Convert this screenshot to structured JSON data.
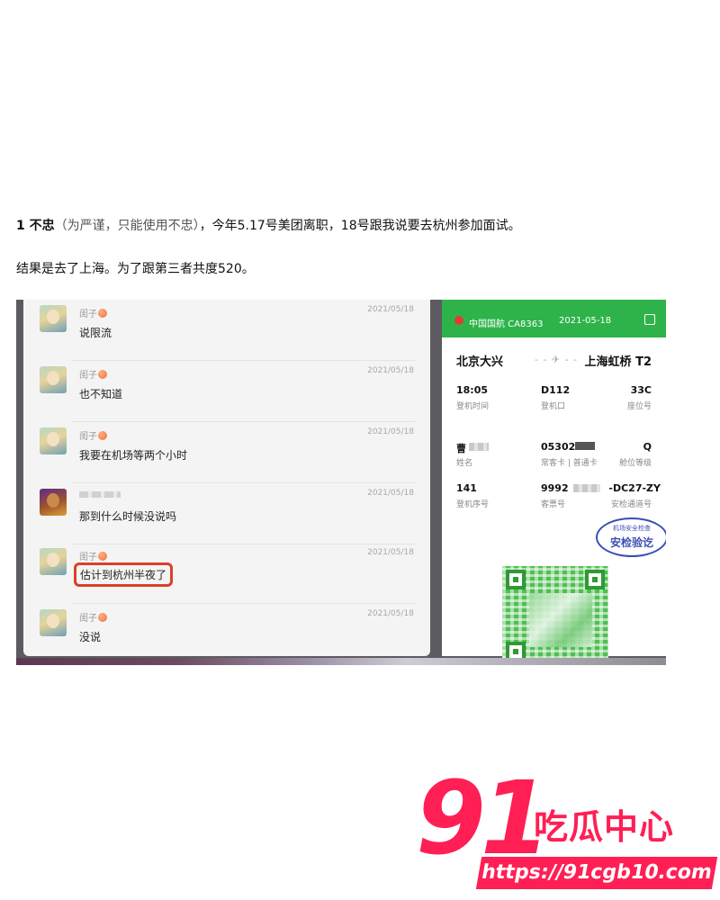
{
  "article": {
    "p1_bold": "1 不忠",
    "p1_paren": "（为严谨，只能使用不忠）",
    "p1_rest": "，今年5.17号美团离职，18号跟我说要去杭州参加面试。",
    "p2": "结果是去了上海。为了跟第三者共度520。"
  },
  "chat": {
    "messages": [
      {
        "sender": "闺子",
        "date": "2021/05/18",
        "text": "说限流"
      },
      {
        "sender": "闺子",
        "date": "2021/05/18",
        "text": "也不知道"
      },
      {
        "sender": "闺子",
        "date": "2021/05/18",
        "text": "我要在机场等两个小时"
      },
      {
        "sender": "",
        "date": "2021/05/18",
        "text": "那到什么时候没说吗"
      },
      {
        "sender": "闺子",
        "date": "2021/05/18",
        "text": "估计到杭州半夜了",
        "highlighted": true
      },
      {
        "sender": "闺子",
        "date": "2021/05/18",
        "text": "没说"
      }
    ]
  },
  "boarding_pass": {
    "airline": "中国国航 CA8363",
    "date": "2021-05-18",
    "from": "北京大兴",
    "to": "上海虹桥 T2",
    "boarding_time": "18:05",
    "boarding_time_label": "登机时间",
    "gate": "D112",
    "gate_label": "登机口",
    "seat": "33C",
    "seat_label": "座位号",
    "name_value": "曹",
    "name_label": "姓名",
    "ffp_value": "05302",
    "ffp_label": "常客卡 | 普通卡",
    "cabin_value": "Q",
    "cabin_label": "舱位等级",
    "seq_value": "141",
    "seq_label": "登机序号",
    "ticket_value": "9992",
    "ticket_label": "客票号",
    "lane_value": "-DC27-ZY",
    "lane_label": "安检通道号",
    "stamp_top": "机场安全检查",
    "stamp_main": "安检验讫"
  },
  "watermark": {
    "number": "91",
    "text": "吃瓜中心",
    "url": "https://91cgb10.com"
  },
  "colors": {
    "pass_green": "#2eb34a",
    "highlight_red": "#d9402a",
    "watermark_pink": "#ff1f55"
  }
}
